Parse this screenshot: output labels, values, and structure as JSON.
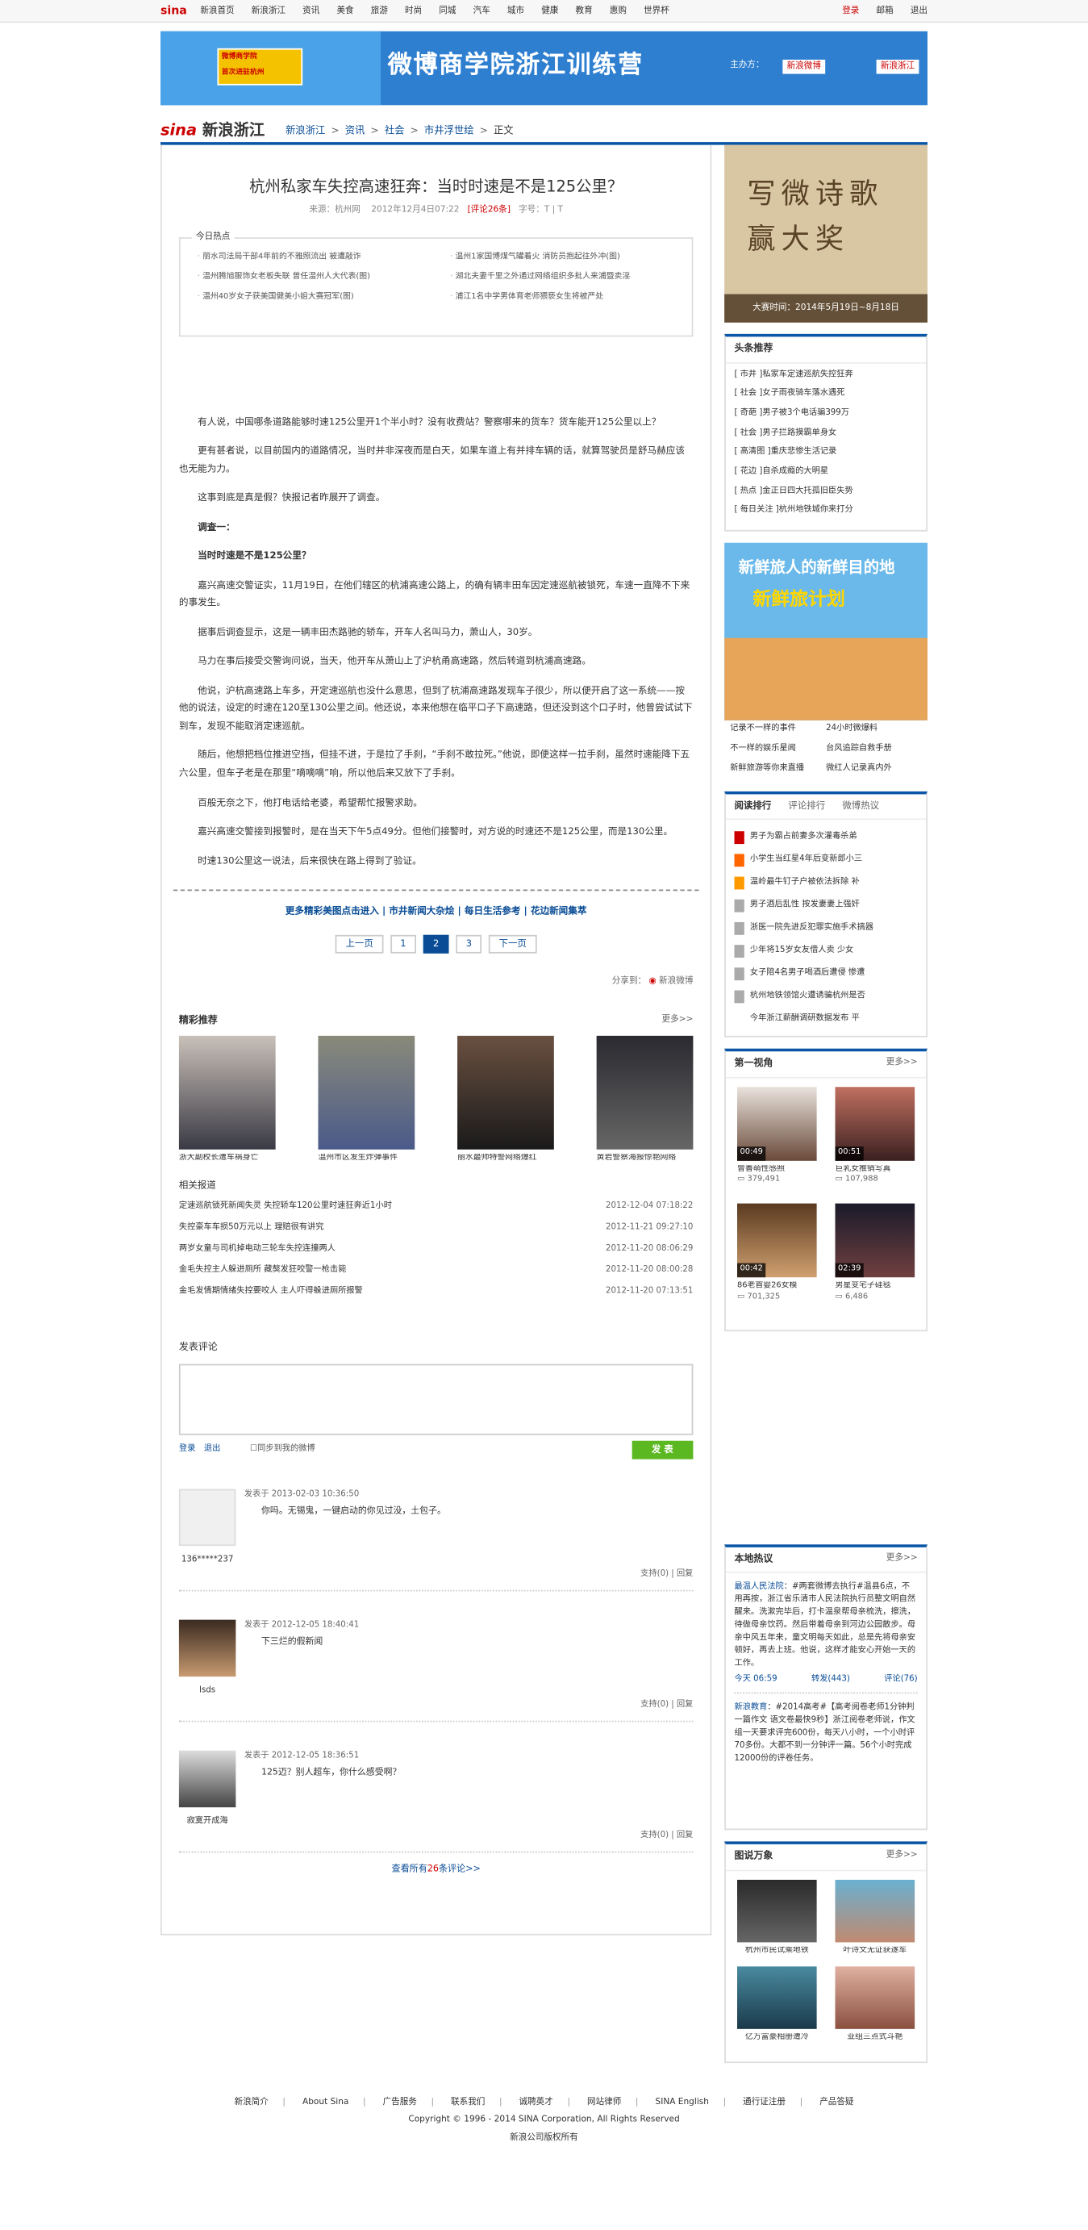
{
  "topbar": {
    "logo": "sina",
    "nav": [
      "新浪首页",
      "新浪浙江",
      "资讯",
      "美食",
      "旅游",
      "时尚",
      "同城",
      "汽车",
      "城市",
      "健康",
      "教育",
      "惠购",
      "世界杯"
    ],
    "right": [
      "登录",
      "邮箱",
      "退出"
    ]
  },
  "banner": {
    "tag1": "微博商学院",
    "tag2": "首次进驻杭州",
    "title": "微博商学院浙江训练营",
    "host_label": "主办方：",
    "weibo": "新浪微博",
    "sina": "新浪浙江"
  },
  "crumb": {
    "logo_s": "sina",
    "logo_t": "新浪浙江",
    "items": [
      "新浪浙江",
      "资讯",
      "社会",
      "市井浮世绘"
    ],
    "current": "正文"
  },
  "article": {
    "title": "杭州私家车失控高速狂奔：当时时速是不是125公里？",
    "meta_source": "来源：",
    "meta_source_name": "杭州网",
    "meta_time": "2012年12月4日07:22",
    "meta_comments": "[评论26条]",
    "meta_font": "字号：T | T",
    "hot_label": "今日热点",
    "hot_left": [
      "丽水司法局干部4年前的不雅照流出 被遭敲诈",
      "温州腾旭服饰女老板失联 曾任温州人大代表(图)",
      "温州40岁女子获美国健美小姐大赛冠军(图)"
    ],
    "hot_right": [
      "温州1家国博煤气罐着火 消防员抱起往外冲(图)",
      "湖北夫妻千里之外通过网络组织多批人来浦暨卖淫",
      "浦江1名中学男体育老师猥亵女生将被严处"
    ],
    "paragraphs": [
      "有人说，中国哪条道路能够时速125公里开1个半小时？没有收费站？警察哪来的货车？货车能开125公里以上？",
      "更有甚者说，以目前国内的道路情况，当时并非深夜而是白天，如果车道上有并排车辆的话，就算驾驶员是舒马赫应该也无能为力。",
      "这事到底是真是假？快报记者昨展开了调查。",
      "调查一：",
      "当时时速是不是125公里？",
      "嘉兴高速交警证实，11月19日，在他们辖区的杭浦高速公路上，的确有辆丰田车因定速巡航被锁死，车速一直降不下来的事发生。",
      "据事后调查显示，这是一辆丰田杰路驰的轿车，开车人名叫马力，萧山人，30岁。",
      "马力在事后接受交警询问说，当天，他开车从萧山上了沪杭甬高速路，然后转道到杭浦高速路。",
      "他说，沪杭高速路上车多，开定速巡航也没什么意思，但到了杭浦高速路发现车子很少，所以便开启了这一系统——按他的说法，设定的时速在120至130公里之间。他还说，本来他想在临平口子下高速路，但还没到这个口子时，他曾尝试试下到车，发现不能取消定速巡航。",
      "随后，他想把档位推进空挡，但挂不进，于是拉了手刹，“手刹不敢拉死。”他说，即便这样一拉手刹，虽然时速能降下五六公里，但车子老是在那里“嘀嘀嘀”响，所以他后来又放下了手刹。",
      "百般无奈之下，他打电话给老婆，希望帮忙报警求助。",
      "嘉兴高速交警接到报警时，是在当天下午5点49分。但他们接警时，对方说的时速还不是125公里，而是130公里。",
      "时速130公里这一说法，后来很快在路上得到了验证。"
    ],
    "more_links": "更多精彩美图点击进入 | 市井新闻大杂烩 | 每日生活参考 | 花边新闻集萃",
    "pager": [
      "上一页",
      "1",
      "2",
      "3",
      "下一页"
    ],
    "share": "分享到：",
    "share_weibo": "新浪微博",
    "rec_title": "精彩推荐",
    "rec_more": "更多>>",
    "rec": [
      "浙大副校长遭车祸身亡",
      "温州市区发生炸弹事件",
      "丽水最帅特警网络爆红",
      "黄岩警察海报惊艳网络"
    ],
    "related_title": "相关报道",
    "related": [
      {
        "t": "定速巡航锁死新闻失灵 失控轿车120公里时速狂奔近1小时",
        "d": "2012-12-04 07:18:22"
      },
      {
        "t": "失控豪车车损50万元以上 理赔很有讲究",
        "d": "2012-11-21 09:27:10"
      },
      {
        "t": "两岁女童与司机掉电动三轮车失控连撞两人",
        "d": "2012-11-20 08:06:29"
      },
      {
        "t": "金毛失控主人躲进厕所 藏獒发狂咬警一枪击毙",
        "d": "2012-11-20 08:00:28"
      },
      {
        "t": "金毛发情期情绪失控要咬人 主人吓得躲进厕所报警",
        "d": "2012-11-20 07:13:51"
      }
    ],
    "comment_title": "发表评论",
    "login": "登录",
    "logout": "退出",
    "sync": "同步到我的微博",
    "submit": "发 表",
    "comments": [
      {
        "name": "136*****237",
        "time": "发表于 2013-02-03 10:36:50",
        "text": "你吗。无锡鬼，一键启动的你见过没，土包子。",
        "act": "支持(0) | 回复"
      },
      {
        "name": "lsds",
        "time": "发表于 2012-12-05 18:40:41",
        "text": "下三烂的假新闻",
        "act": "支持(0) | 回复"
      },
      {
        "name": "寂寞开成海",
        "time": "发表于 2012-12-05 18:36:51",
        "text": "125迈？别人超车，你什么感受啊？",
        "act": "支持(0) | 回复"
      }
    ],
    "all_comments_pre": "查看所有",
    "all_comments_num": "26",
    "all_comments_post": "条评论>>"
  },
  "side": {
    "ad1_l1": "写微诗歌",
    "ad1_l2": "赢大奖",
    "ad1_date": "大赛时间：2014年5月19日~8月18日",
    "headlines_title": "头条推荐",
    "headlines": [
      "[ 市井 ]私家车定速巡航失控狂奔",
      "[ 社会 ]女子雨夜骑车落水遇死",
      "[ 奇葩 ]男子被3个电话骗399万",
      "[ 社会 ]男子拦路摸霸单身女",
      "[ 高清图 ]重庆悲惨生活记录",
      "[ 花边 ]自杀成瘾的大明星",
      "[ 热点 ]金正日四大托孤旧臣失势",
      "[ 每日关注 ]杭州地铁城你来打分"
    ],
    "ad2_a": "新鲜旅人的新鲜目的地",
    "ad2_b": "新鲜旅计划",
    "ad2_links": [
      "记录不一样的事件",
      "24小时微爆料",
      "不一样的娱乐星闻",
      "台风追踪自救手册",
      "新鲜旅游等你来直播",
      "微红人记录真内外"
    ],
    "rank_tabs": [
      "阅读排行",
      "评论排行",
      "微博热议"
    ],
    "rank": [
      "男子为霸占前妻多次灌毒杀弟",
      "小学生当红星4年后变新郎小三",
      "温岭最牛钉子户被依法拆除 补",
      "男子酒后乱性 按发妻妻上强奸",
      "浙医一院先进反犯罪实施手术搞器",
      "少年将15岁女友借人卖 少女",
      "女子陪4名男子喝酒后遭侵 惨遭",
      "杭州地铁领馆火遭诱骗杭州是否",
      "今年浙江薪酬调研数据发布 平"
    ],
    "rank_colors": [
      "#c00",
      "#f60",
      "#f90",
      "#999",
      "#999",
      "#999",
      "#999",
      "#999",
      ""
    ],
    "video_title": "第一视角",
    "video_more": "更多>>",
    "videos": [
      {
        "dur": "00:49",
        "cap": "曾善萌性感照",
        "cnt": "379,491"
      },
      {
        "dur": "00:51",
        "cap": "巨乳女推销写真",
        "cnt": "107,988"
      },
      {
        "dur": "00:42",
        "cap": "86老首婴26女模",
        "cnt": "701,325"
      },
      {
        "dur": "02:39",
        "cap": "男星变宅子硅毯",
        "cnt": "6,486"
      }
    ],
    "local_title": "本地热议",
    "local_more": "更多>>",
    "local_who": "最温人民法院",
    "local_text": "：#两套微博去执行#温县6点，不用再按，浙江省乐清市人民法院执行员整文明自然醒来。洗漱完毕后，打卡温泉帮母亲梳洗，擦洗，待做母亲饮药。然后带着母亲到河边公园散步。母亲中风五年来，童文明每天如此，总是先将母亲安顿好，再去上班。他说，这样才能安心开始一天的工作。",
    "local_row": [
      "今天 06:59",
      "转发(443)",
      "评论(76)"
    ],
    "local_who2": "新浪教育",
    "local_text2": "：#2014高考#【高考阅卷老师1分钟判一篇作文 语文卷最快9秒】浙江阅卷老师说，作文组一天要求评完600份，每天八小时，一个小时评70多份。大都不到一分钟评一篇。56个小时完成12000份的评卷任务。",
    "pics_title": "图说万象",
    "pics_more": "更多>>",
    "pics": [
      "杭州市民试乘地铁",
      "叶诗文无证获遂车",
      "亿万富豪相册遭冷",
      "亚组三点式斗艳"
    ]
  },
  "footer": {
    "links": [
      "新浪简介",
      "About Sina",
      "广告服务",
      "联系我们",
      "诚聘英才",
      "网站律师",
      "SINA English",
      "通行证注册",
      "产品答疑"
    ],
    "copyright": "Copyright © 1996 - 2014 SINA Corporation, All Rights Reserved",
    "owner": "新浪公司版权所有"
  }
}
